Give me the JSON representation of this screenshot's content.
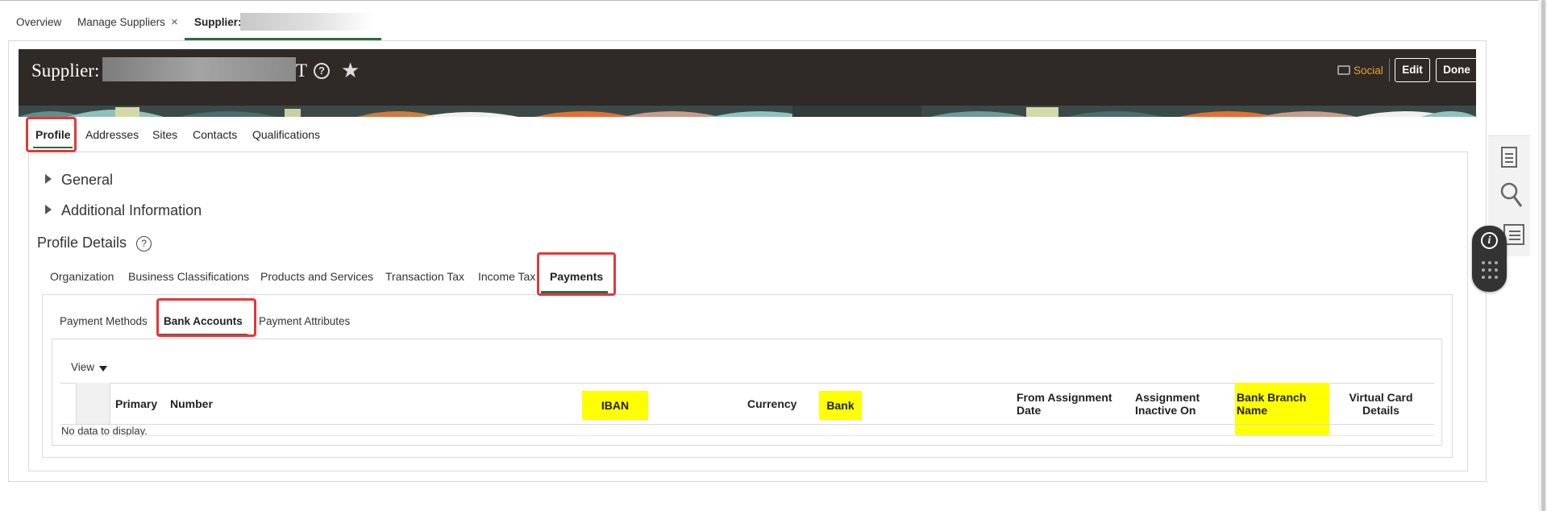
{
  "page_tabs": [
    {
      "label": "Overview"
    },
    {
      "label": "Manage Suppliers",
      "close": "×"
    },
    {
      "label": "Supplier:",
      "active": true
    }
  ],
  "header": {
    "title_prefix": "Supplier:",
    "title_suffix": "T",
    "help": "?",
    "star": "★",
    "social_label": "Social",
    "edit_label": "Edit",
    "done_label": "Done"
  },
  "main_tabs": [
    "Profile",
    "Addresses",
    "Sites",
    "Contacts",
    "Qualifications"
  ],
  "disclosures": [
    "General",
    "Additional Information"
  ],
  "section": {
    "title": "Profile Details",
    "help": "?"
  },
  "profile_tabs": [
    "Organization",
    "Business Classifications",
    "Products and Services",
    "Transaction Tax",
    "Income Tax",
    "Payments"
  ],
  "payment_tabs": [
    "Payment Methods",
    "Bank Accounts",
    "Payment Attributes"
  ],
  "table": {
    "view_label": "View",
    "columns": {
      "primary": "Primary",
      "number": "Number",
      "iban": "IBAN",
      "currency": "Currency",
      "bank": "Bank",
      "from_date_1": "From Assignment",
      "from_date_2": "Date",
      "inactive_1": "Assignment",
      "inactive_2": "Inactive On",
      "branch_1": "Bank Branch",
      "branch_2": "Name",
      "virtual_1": "Virtual Card",
      "virtual_2": "Details"
    },
    "empty_message": "No data to display."
  },
  "side_tools": {
    "info": "i"
  },
  "colors": {
    "banner": "#2f2a26",
    "accent_green": "#2e6a3e",
    "highlight_box": "#e0393e",
    "highlight_fill": "#ffff00",
    "social": "#e3a338"
  }
}
